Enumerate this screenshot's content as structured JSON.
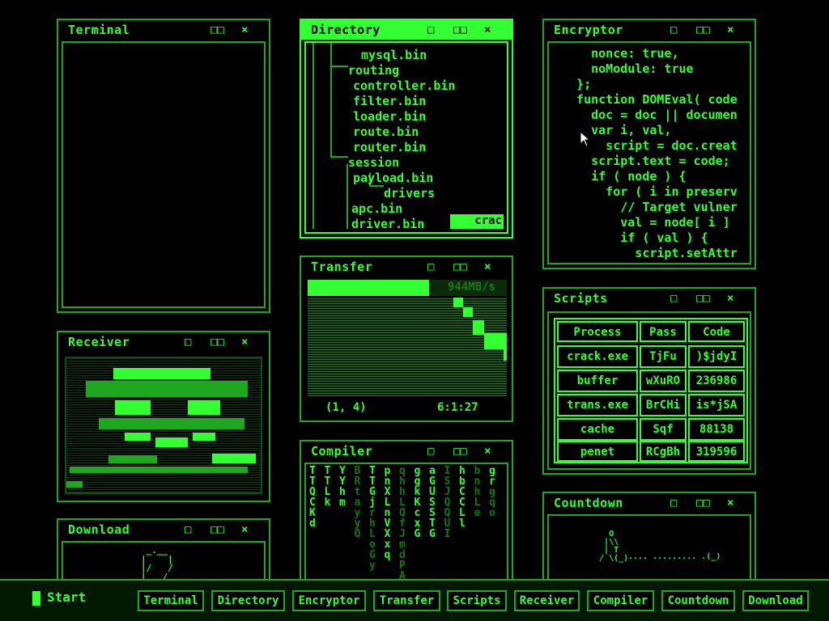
{
  "windows": {
    "terminal": {
      "title": "Terminal"
    },
    "directory": {
      "title": "Directory",
      "items": [
        "mysql.bin",
        "routing",
        "controller.bin",
        "filter.bin",
        "loader.bin",
        "route.bin",
        "router.bin",
        "session",
        "payload.bin",
        "drivers",
        "apc.bin",
        "driver.bin"
      ],
      "action_label": "crac"
    },
    "encryptor": {
      "title": "Encryptor",
      "code": [
        "    nonce: true,",
        "    noModule: true",
        "  };",
        "  function DOMEval( code",
        "    doc = doc || documen",
        "    var i, val,",
        "      script = doc.creat",
        "    script.text = code;",
        "    if ( node ) {",
        "      for ( i in preserv",
        "        // Target vulner",
        "        val = node[ i ]",
        "        if ( val ) {",
        "          script.setAttr"
      ]
    },
    "transfer": {
      "title": "Transfer",
      "speed": "944MB/s",
      "coords": "(1, 4)",
      "time": "6:1:27"
    },
    "compiler": {
      "title": "Compiler",
      "columns": [
        "TTQCKd",
        "TTLk",
        "YYhm",
        "",
        "TTGj",
        "pnXLnVXxq",
        "",
        "ggkKcxG",
        "aGUSSTG",
        "",
        "hbCCLl",
        "",
        "gr"
      ],
      "faded": [
        "",
        "",
        "",
        "BRtayyQ",
        "rhLoGy",
        "",
        "qhhLQfJmdPAS",
        "",
        "",
        "ISJQQUI",
        "",
        "bnhLe",
        "gqo"
      ]
    },
    "scripts": {
      "title": "Scripts",
      "headers": [
        "Process",
        "Pass",
        "Code"
      ],
      "rows": [
        [
          "crack.exe",
          "TjFu",
          ")$jdyI"
        ],
        [
          "buffer",
          "wXuRO",
          "236986"
        ],
        [
          "trans.exe",
          "BrCHi",
          "is*jSA"
        ],
        [
          "cache",
          "Sqf",
          "88138"
        ],
        [
          "penet",
          "RCgBh",
          "319596"
        ]
      ]
    },
    "receiver": {
      "title": "Receiver"
    },
    "download": {
      "title": "Download"
    },
    "countdown": {
      "title": "Countdown"
    }
  },
  "controls": {
    "minimize": "□",
    "maximize": "□□",
    "close": "×"
  },
  "taskbar": {
    "start": "Start",
    "items": [
      "Terminal",
      "Directory",
      "Encryptor",
      "Transfer",
      "Scripts",
      "Receiver",
      "Compiler",
      "Countdown",
      "Download"
    ]
  },
  "colors": {
    "accent": "#33ff33",
    "dim": "#1fa81f",
    "background": "#000000",
    "taskbar": "#001900"
  }
}
